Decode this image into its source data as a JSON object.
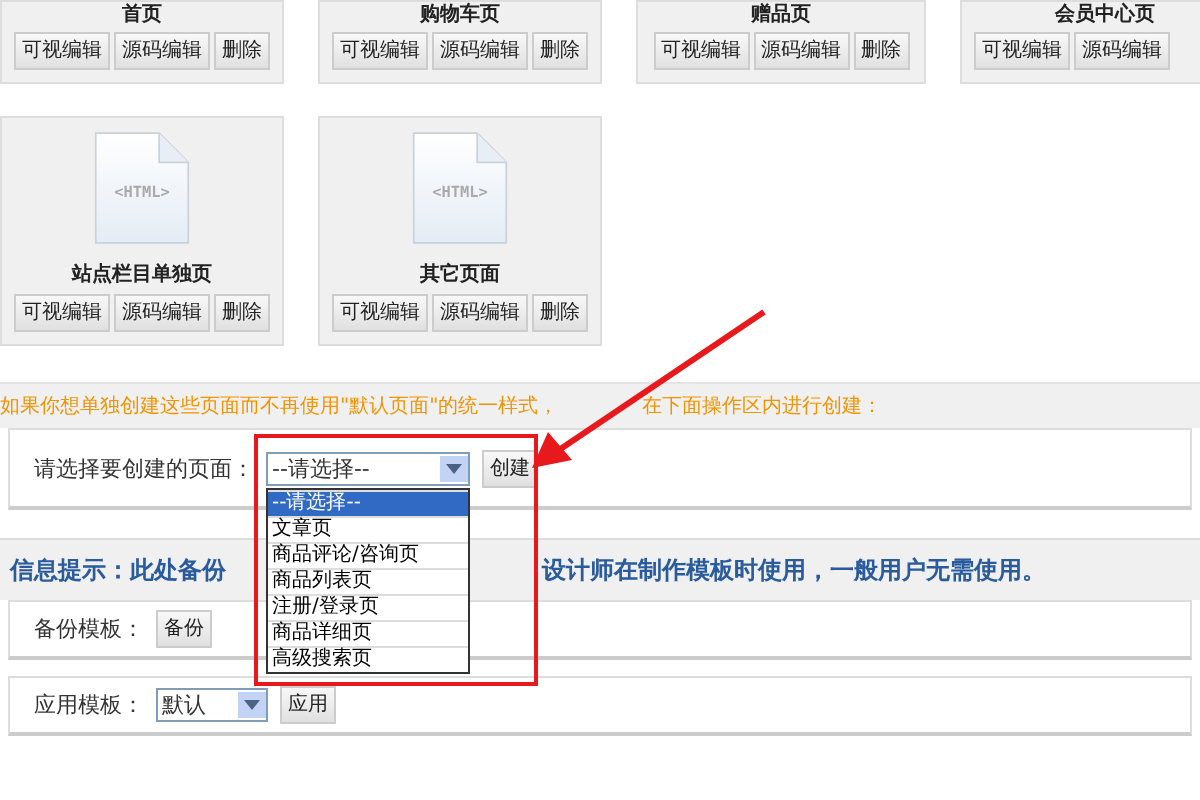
{
  "cards": [
    {
      "title": "首页",
      "buttons": [
        "可视编辑",
        "源码编辑",
        "删除"
      ]
    },
    {
      "title": "购物车页",
      "buttons": [
        "可视编辑",
        "源码编辑",
        "删除"
      ]
    },
    {
      "title": "赠品页",
      "buttons": [
        "可视编辑",
        "源码编辑",
        "删除"
      ]
    },
    {
      "title": "会员中心页",
      "buttons": [
        "可视编辑",
        "源码编辑"
      ]
    },
    {
      "title": "站点栏目单独页",
      "icon_text": "<HTML>",
      "buttons": [
        "可视编辑",
        "源码编辑",
        "删除"
      ]
    },
    {
      "title": "其它页面",
      "icon_text": "<HTML>",
      "buttons": [
        "可视编辑",
        "源码编辑",
        "删除"
      ]
    }
  ],
  "notice_parts": [
    "如果你想单独创建这些页面而不再使用\"默认页面\"的统一样式，",
    "在下面操作区内进行创建："
  ],
  "create": {
    "label": "请选择要创建的页面：",
    "select": {
      "value": "--请选择--"
    },
    "button": "创建",
    "dropdown": {
      "options": [
        {
          "label": "--请选择--",
          "selected": true
        },
        {
          "label": "文章页",
          "selected": false
        },
        {
          "label": "商品评论/咨询页",
          "selected": false
        },
        {
          "label": "商品列表页",
          "selected": false
        },
        {
          "label": "注册/登录页",
          "selected": false
        },
        {
          "label": "商品详细页",
          "selected": false
        },
        {
          "label": "高级搜索页",
          "selected": false
        }
      ]
    }
  },
  "info_parts": [
    "信息提示：此处备份",
    "设计师在制作模板时使用，一般用户无需使用。"
  ],
  "backup": {
    "label": "备份模板：",
    "button": "备份"
  },
  "apply": {
    "label": "应用模板：",
    "select": {
      "value": "默认"
    },
    "button": "应用"
  }
}
